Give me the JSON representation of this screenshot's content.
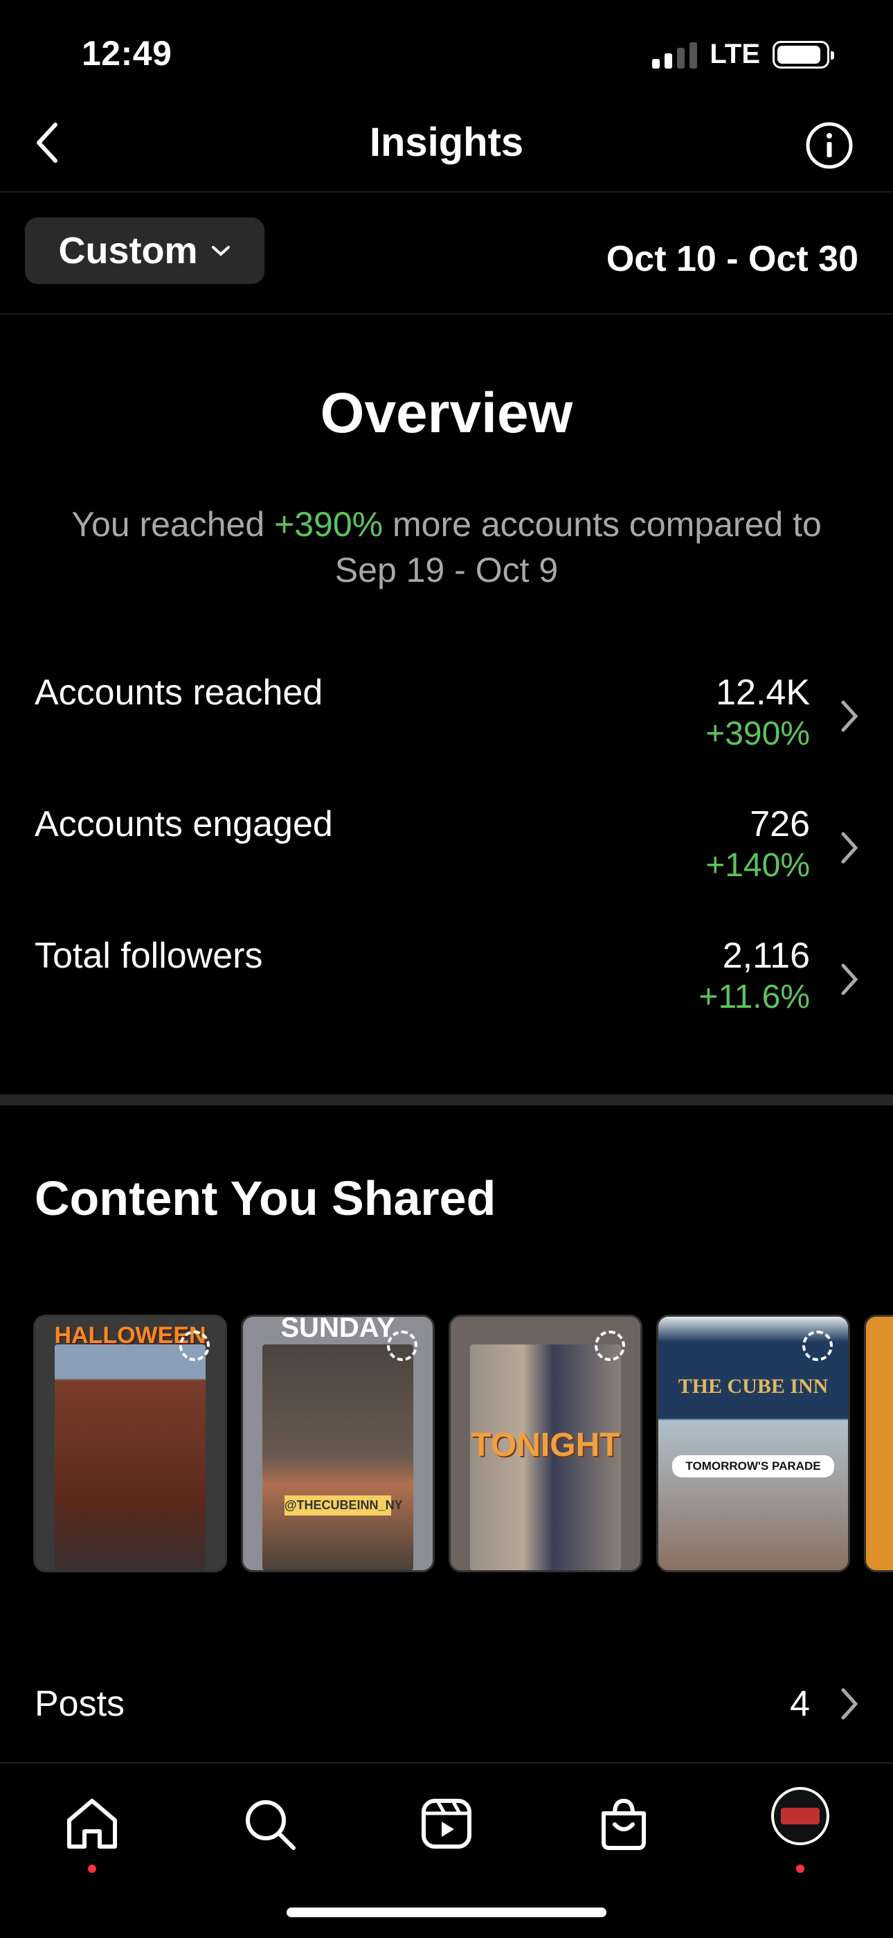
{
  "status_bar": {
    "time": "12:49",
    "network": "LTE",
    "battery_percent": 85
  },
  "header": {
    "title": "Insights"
  },
  "date_filter": {
    "label": "Custom",
    "range": "Oct 10 - Oct 30"
  },
  "overview": {
    "title": "Overview",
    "summary_prefix": "You reached ",
    "summary_highlight": "+390%",
    "summary_suffix": " more accounts compared to Sep 19 - Oct 9"
  },
  "metrics": [
    {
      "label": "Accounts reached",
      "value": "12.4K",
      "change": "+390%"
    },
    {
      "label": "Accounts engaged",
      "value": "726",
      "change": "+140%"
    },
    {
      "label": "Total followers",
      "value": "2,116",
      "change": "+11.6%"
    }
  ],
  "content_shared": {
    "title": "Content You Shared",
    "thumbnails": [
      {
        "caption": "HALLOWEEN",
        "color": "#7a3d2a"
      },
      {
        "caption": "SUNDAY",
        "sub": "@THECUBEINN_NY",
        "color": "#5a5550"
      },
      {
        "caption": "TONIGHT",
        "color": "#8a7f78"
      },
      {
        "caption": "THE CUBE INN",
        "sub": "TOMORROW'S PARADE",
        "color": "#c9d4dc"
      }
    ]
  },
  "posts": {
    "label": "Posts",
    "count": "4"
  },
  "tabs": [
    "home",
    "search",
    "reels",
    "shop",
    "profile"
  ]
}
